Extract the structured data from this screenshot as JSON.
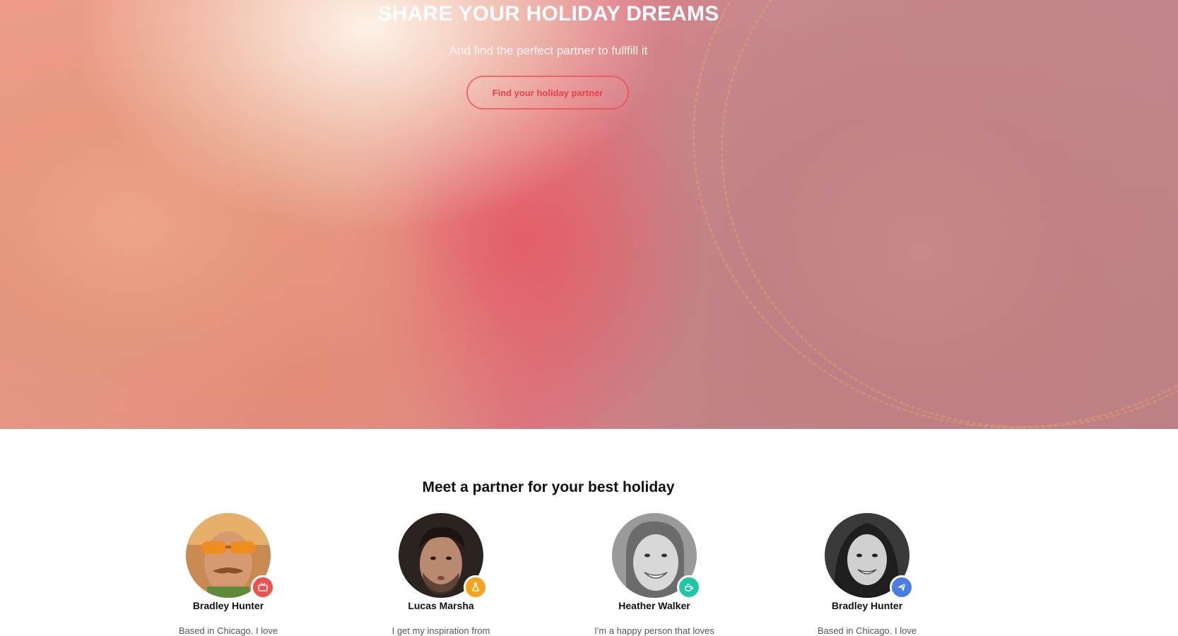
{
  "hero": {
    "title": "SHARE YOUR HOLIDAY DREAMS",
    "subtitle": "And find the perfect partner to fullfill it",
    "cta_label": "Find your holiday partner"
  },
  "partners": {
    "title": "Meet a partner for your best holiday",
    "items": [
      {
        "name": "Bradley Hunter",
        "bio": "Based in Chicago. I love",
        "badge_icon": "tv-icon",
        "badge_color": "#f24e4e"
      },
      {
        "name": "Lucas Marsha",
        "bio": "I get my inspiration from",
        "badge_icon": "flask-icon",
        "badge_color": "#f7a21b"
      },
      {
        "name": "Heather Walker",
        "bio": "I'm a happy person that loves",
        "badge_icon": "coffee-cup-icon",
        "badge_color": "#1fc8a4"
      },
      {
        "name": "Bradley Hunter",
        "bio": "Based in Chicago. I love",
        "badge_icon": "paper-plane-icon",
        "badge_color": "#4a7de3"
      }
    ]
  }
}
